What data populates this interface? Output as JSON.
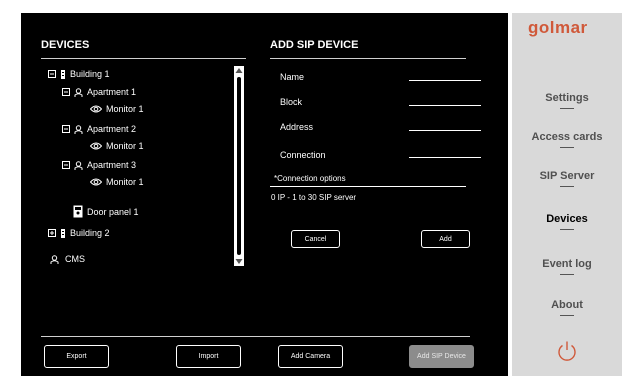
{
  "brand": {
    "logo_text": "golmar",
    "accent_color": "#d0593a"
  },
  "devices": {
    "title": "DEVICES",
    "tree": [
      {
        "label": "Building 1",
        "icon": "building-icon",
        "expander": "minus"
      },
      {
        "label": "Apartment 1",
        "icon": "person-icon",
        "expander": "minus"
      },
      {
        "label": "Monitor 1",
        "icon": "eye-icon"
      },
      {
        "label": "Apartment 2",
        "icon": "person-icon",
        "expander": "minus"
      },
      {
        "label": "Monitor 1",
        "icon": "eye-icon"
      },
      {
        "label": "Apartment 3",
        "icon": "person-icon",
        "expander": "minus"
      },
      {
        "label": "Monitor 1",
        "icon": "eye-icon"
      },
      {
        "label": "Door panel 1",
        "icon": "door-panel-icon"
      },
      {
        "label": "Building 2",
        "icon": "building-icon",
        "expander": "plus"
      },
      {
        "label": "CMS",
        "icon": "person-icon"
      }
    ]
  },
  "add_sip": {
    "title": "ADD SIP DEVICE",
    "fields": [
      {
        "label": "Name",
        "value": ""
      },
      {
        "label": "Block",
        "value": ""
      },
      {
        "label": "Address",
        "value": ""
      },
      {
        "label": "Connection",
        "value": ""
      }
    ],
    "connection_options_label": "*Connection options",
    "connection_options_text": "0 IP - 1 to 30 SIP server",
    "cancel_label": "Cancel",
    "add_label": "Add"
  },
  "bottom_bar": {
    "export_label": "Export",
    "import_label": "Import",
    "add_camera_label": "Add Camera",
    "add_sip_device_label": "Add SIP Device"
  },
  "sidebar": {
    "items": [
      {
        "label": "Settings",
        "active": false
      },
      {
        "label": "Access cards",
        "active": false
      },
      {
        "label": "SIP Server",
        "active": false
      },
      {
        "label": "Devices",
        "active": true
      },
      {
        "label": "Event log",
        "active": false
      },
      {
        "label": "About",
        "active": false
      }
    ],
    "power_icon": "power-icon"
  }
}
